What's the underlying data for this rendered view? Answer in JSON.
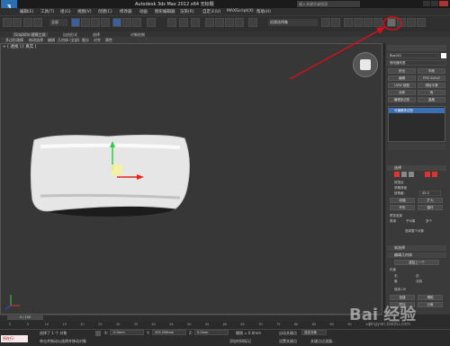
{
  "window": {
    "logo": "3",
    "title": "Autodesk 3ds Max 2012 x64     无标题",
    "search_placeholder": "键入关键字或短语"
  },
  "menus": [
    "编辑(E)",
    "工具(T)",
    "组(G)",
    "视图(V)",
    "创建(C)",
    "修改器",
    "动画",
    "图形编辑器",
    "渲染(R)",
    "自定义(U)",
    "MAXScript(X)",
    "帮助(H)"
  ],
  "toolbar": {
    "filter_value": "全部",
    "selection_set_placeholder": "创建选择集"
  },
  "ribbon": {
    "tabs": [
      "Graphite 建模工具",
      "自由形式",
      "选择",
      "对象绘制"
    ],
    "active_tab": "Graphite 建模工具",
    "sub_items": [
      "多边形建模",
      "修改选择",
      "编辑",
      "几何体 (全部)",
      "细分",
      "对齐",
      "属性"
    ]
  },
  "viewport": {
    "label": "+ [ 透视 ] [ 真实 ]"
  },
  "command_panel": {
    "object_name": "Box001",
    "modifier_list": "修改器列表",
    "buttons": [
      "挤出",
      "车削",
      "编辑",
      "FFD 2x2x2",
      "UVW 贴图",
      "涡轮平滑",
      "对称",
      "壳",
      "编辑多边形",
      "晶格"
    ],
    "stack_item": "可编辑多边形",
    "selection_section": "选择",
    "selection_options": [
      "按顶点",
      "忽略背面",
      "按角度:",
      "收缩",
      "扩大",
      "环形",
      "循环"
    ],
    "angle_value": "45.0",
    "preview_label": "预览选择",
    "preview_options": [
      "禁用",
      "子对象",
      "多个"
    ],
    "selected_count": "选择整个对象",
    "soft_selection": "软选择",
    "edit_geometry": "编辑几何体",
    "repeat_last": "重复上一个",
    "constraints": "约束",
    "constraint_options": [
      "无",
      "边",
      "面",
      "法线"
    ],
    "preserve_uvs": "保持 UV",
    "create": "创建",
    "collapse": "塌陷",
    "attach": "附加",
    "detach": "分离"
  },
  "timeline": {
    "slider": "0 / 100",
    "ticks": [
      "0",
      "5",
      "10",
      "15",
      "20",
      "25",
      "30",
      "35",
      "40",
      "45",
      "50",
      "55",
      "60",
      "65",
      "70",
      "75",
      "80",
      "85",
      "90",
      "95",
      "100"
    ]
  },
  "status": {
    "mode": "所在行:",
    "selection": "选择了 1 个 对象",
    "prompt": "单击并拖动以选择并移动对象",
    "x_label": "X:",
    "x_value": "-0.0mm",
    "y_label": "Y:",
    "y_value": "205.208mm",
    "z_label": "Z:",
    "z_value": "0.0mm",
    "grid": "栅格 = 0.0mm",
    "auto_key": "自动关键点",
    "set_key": "设置关键点",
    "selected_label": "选定对象",
    "add_time_tag": "添加时间标记",
    "key_filters": "关键点过滤器..."
  },
  "watermark": {
    "text": "Bai 经验",
    "url": "jingyan.baidu.com"
  },
  "annotation_color": "#d0121b",
  "accent_blue": "#2a6fb0"
}
